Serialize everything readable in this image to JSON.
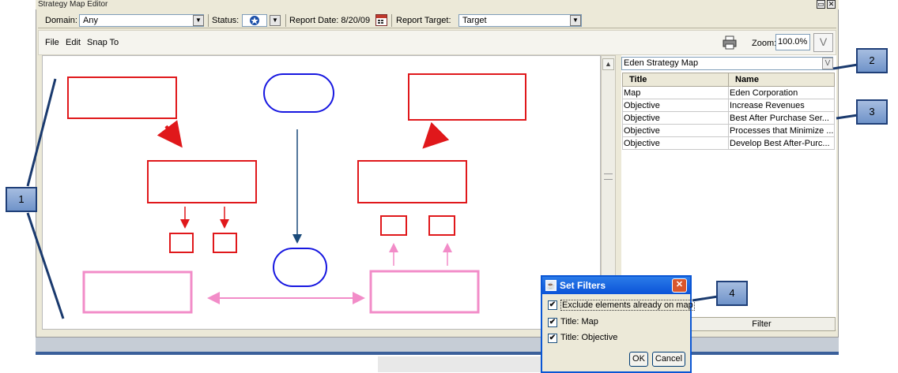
{
  "window": {
    "title": "Strategy Map Editor"
  },
  "toolbar": {
    "domain_label": "Domain:",
    "domain_value": "Any",
    "status_label": "Status:",
    "report_date_label": "Report Date: 8/20/09",
    "report_target_label": "Report Target:",
    "report_target_value": "Target"
  },
  "menu": {
    "file": "File",
    "edit": "Edit",
    "snap_to": "Snap To"
  },
  "zoom": {
    "label": "Zoom:",
    "value": "100.0%",
    "button": "V"
  },
  "right_panel": {
    "map_select_value": "Eden Strategy Map",
    "columns": [
      "Title",
      "Name"
    ],
    "rows": [
      {
        "title": "Map",
        "name": "Eden Corporation"
      },
      {
        "title": "Objective",
        "name": "Increase Revenues"
      },
      {
        "title": "Objective",
        "name": "Best After Purchase Ser..."
      },
      {
        "title": "Objective",
        "name": "Processes that Minimize ..."
      },
      {
        "title": "Objective",
        "name": "Develop Best After-Purc..."
      }
    ],
    "filter_button": "Filter"
  },
  "dialog": {
    "title": "Set Filters",
    "options": [
      {
        "label": "Exclude elements already on map",
        "checked": true
      },
      {
        "label": "Title: Map",
        "checked": true
      },
      {
        "label": "Title: Objective",
        "checked": true
      }
    ],
    "ok": "OK",
    "cancel": "Cancel"
  },
  "callouts": [
    "1",
    "2",
    "3",
    "4"
  ],
  "colors": {
    "red": "#e0181b",
    "blue": "#1717e0",
    "pink": "#f28cc8",
    "navy": "#1a3a6e"
  }
}
